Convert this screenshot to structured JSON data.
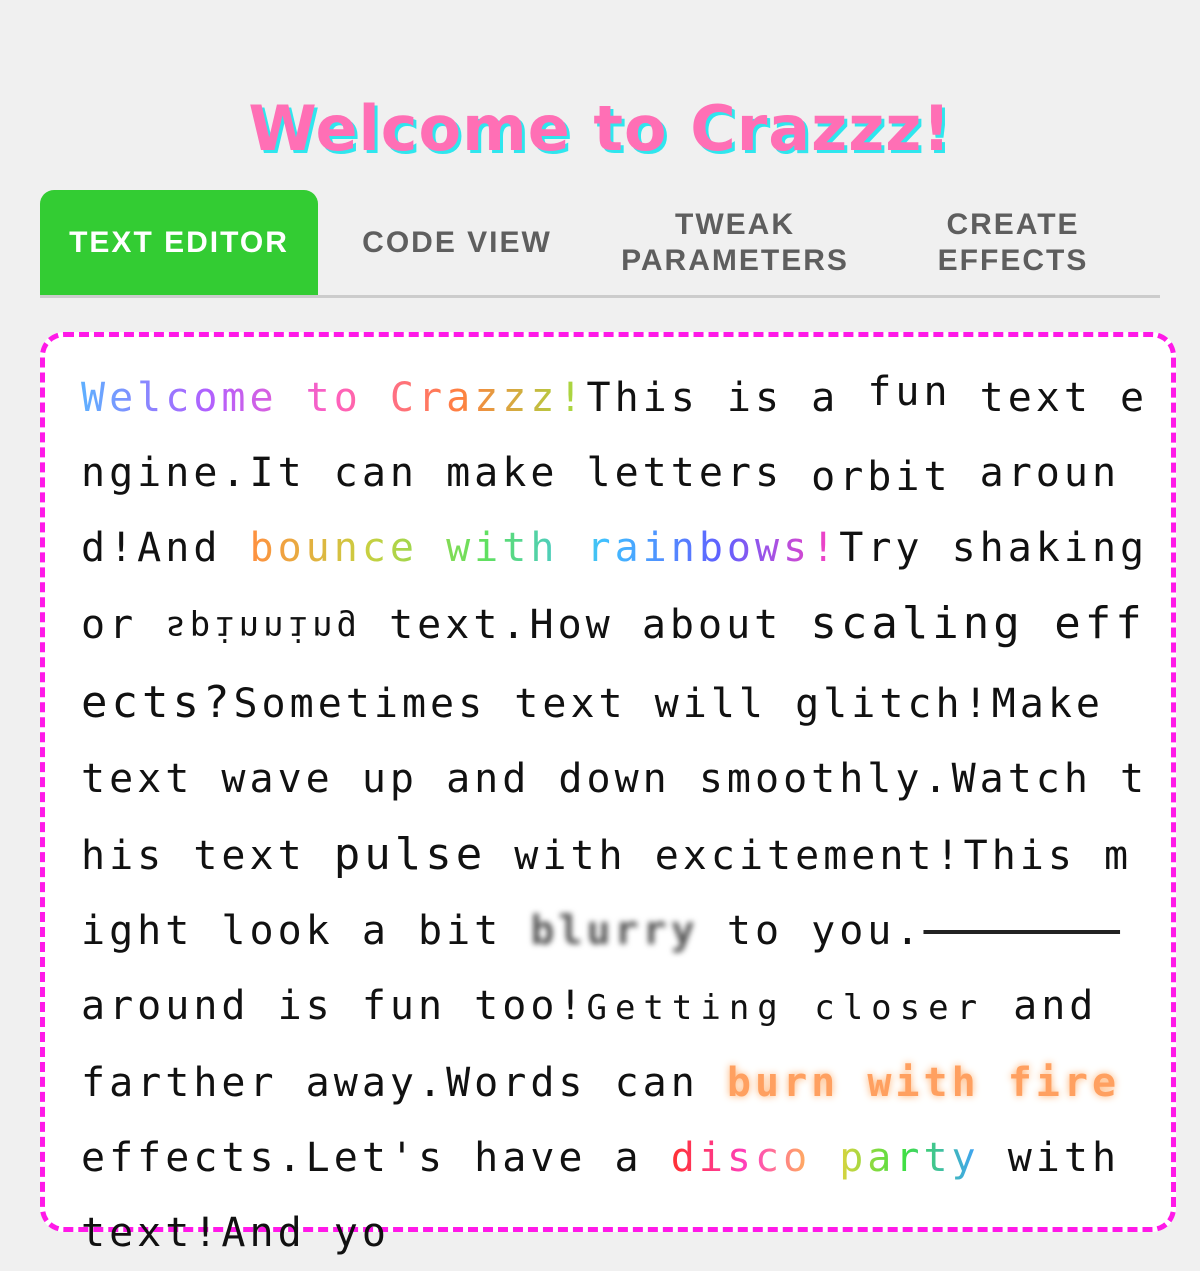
{
  "title": "Welcome to Crazzz!",
  "tabs": [
    {
      "label": "TEXT EDITOR",
      "active": true
    },
    {
      "label": "CODE VIEW",
      "active": false
    },
    {
      "label": "TWEAK PARAMETERS",
      "active": false
    },
    {
      "label": "CREATE EFFECTS",
      "active": false
    }
  ],
  "colors": {
    "accent_tab": "#33cc33",
    "border": "#ff19e8",
    "title": "#ff6fb5",
    "title_shadow": "#2fe6ee"
  },
  "editor": {
    "segments": {
      "s1": "Welcome to Crazzz!",
      "s2": "This is a ",
      "s3": "fun",
      "s4": " text engine.",
      "s5": "It can make letters ",
      "s6": "orbit",
      "s7": " around!",
      "s8": "And ",
      "s9": "bounce with rainbows!",
      "s10": "Try shaking or ",
      "s11": "spinning",
      "s12": " text.",
      "s13": "How about ",
      "s14": "scaling effects?",
      "s15": "Sometimes text will glitch!",
      "s16": "Make text ",
      "s17": "wave up and down",
      "s18": " smoothly.",
      "s19": "Watch this text ",
      "s20": "pulse",
      "s21": " with excitement!",
      "s22": "This might look a bit ",
      "s23": "blurry",
      "s24": " to you.",
      "s25": "sliding",
      "s26": " around is fun too!",
      "s27": "Getting closer",
      "s28": " and farther away.",
      "s29": "Words can ",
      "s30": "burn with fire",
      "s31": " effects.",
      "s32": "Let's have a ",
      "s33": "disco party",
      "s34": " with text!",
      "s35": "And yo"
    }
  }
}
